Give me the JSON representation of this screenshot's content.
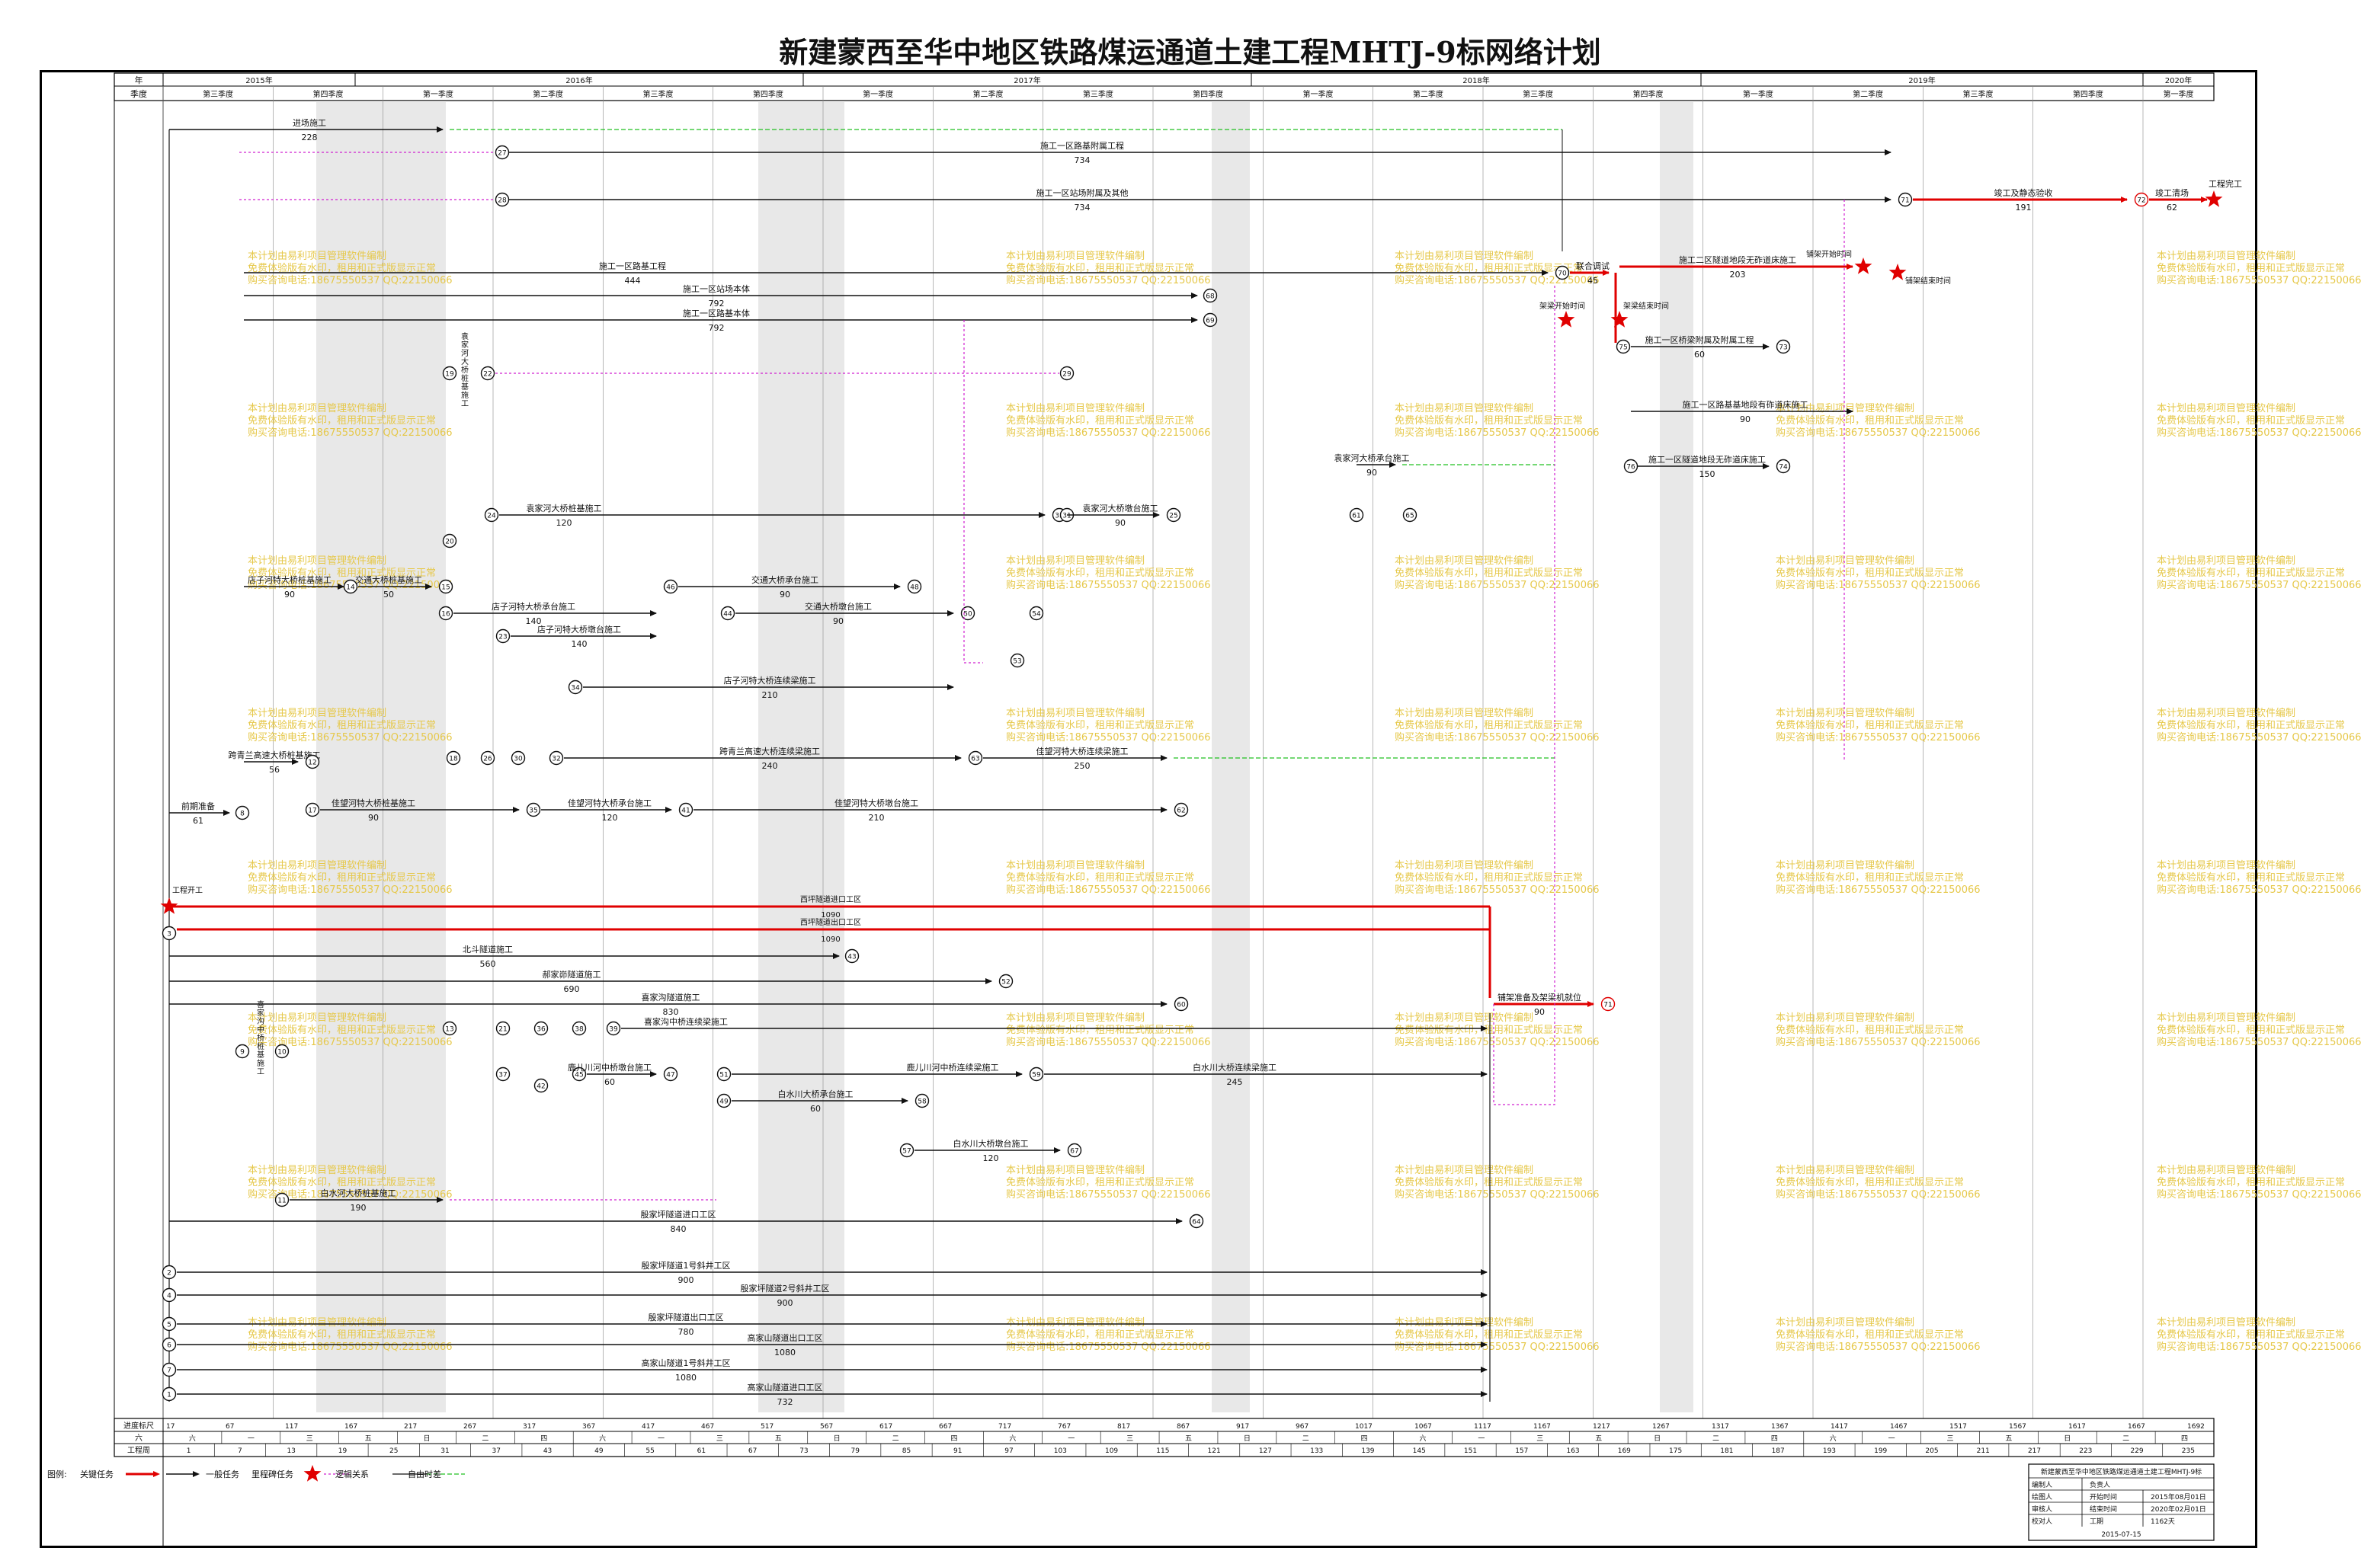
{
  "title": "新建蒙西至华中地区铁路煤运通道土建工程MHTJ-9标网络计划",
  "header": {
    "row1_label": "年",
    "row2_label": "季度",
    "years": [
      "2015年",
      "2016年",
      "2017年",
      "2018年",
      "2019年",
      "2020年"
    ],
    "quarters": [
      "第三季度",
      "第四季度",
      "第一季度",
      "第二季度",
      "第三季度",
      "第四季度",
      "第一季度",
      "第二季度",
      "第三季度",
      "第四季度",
      "第一季度",
      "第二季度",
      "第三季度",
      "第四季度",
      "第一季度",
      "第二季度",
      "第三季度",
      "第四季度",
      "第一季度"
    ]
  },
  "tasks": [
    {
      "name": "进场施工",
      "duration": "228"
    },
    {
      "name": "施工一区路基附属工程",
      "duration": "734"
    },
    {
      "name": "施工一区站场附属及其他",
      "duration": "734"
    },
    {
      "name": "竣工及静态验收",
      "duration": "191"
    },
    {
      "name": "竣工清场",
      "duration": "62"
    },
    {
      "name": "工程完工"
    },
    {
      "name": "施工一区路基工程",
      "duration": "444"
    },
    {
      "name": "施工一区站场本体",
      "duration": "792"
    },
    {
      "name": "施工一区路基本体",
      "duration": "792"
    },
    {
      "name": "联合调试",
      "duration": "45"
    },
    {
      "name": "架梁开始时间"
    },
    {
      "name": "架梁结束时间"
    },
    {
      "name": "施工二区隧道地段无砟道床施工",
      "duration": "203"
    },
    {
      "name": "铺架开始时间"
    },
    {
      "name": "铺架结束时间"
    },
    {
      "name": "施工一区桥梁附属及附属工程",
      "duration": "60"
    },
    {
      "name": "施工一区路基基地段有砟道床施工",
      "duration": "90"
    },
    {
      "name": "施工一区隧道地段无砟道床施工",
      "duration": "150"
    },
    {
      "name": "袁家河大桥桩基施工",
      "duration": "120"
    },
    {
      "name": "袁家河大桥墩台施工",
      "duration": "90"
    },
    {
      "name": "袁家河大桥承台施工",
      "duration": "90"
    },
    {
      "name": "店子河特大桥桩基施工",
      "duration": "90"
    },
    {
      "name": "店子河特大桥承台施工",
      "duration": "140"
    },
    {
      "name": "店子河特大桥墩台施工",
      "duration": "140"
    },
    {
      "name": "交通大桥桩基施工",
      "duration": "50"
    },
    {
      "name": "交通大桥承台施工",
      "duration": "90"
    },
    {
      "name": "交通大桥墩台施工",
      "duration": "90"
    },
    {
      "name": "店子河特大桥连续梁施工",
      "duration": "210"
    },
    {
      "name": "跨青兰高速大桥桩基施工",
      "duration": "56"
    },
    {
      "name": "跨青兰高速大桥连续梁施工",
      "duration": "240"
    },
    {
      "name": "佳望河特大桥连续梁施工",
      "duration": "250"
    },
    {
      "name": "佳望河特大桥桩基施工",
      "duration": "90"
    },
    {
      "name": "佳望河特大桥承台施工",
      "duration": "120"
    },
    {
      "name": "佳望河特大桥墩台施工",
      "duration": "210"
    },
    {
      "name": "前期准备",
      "duration": "61"
    },
    {
      "name": "工程开工"
    },
    {
      "name": "西坪隧道进口工区",
      "duration": "1090"
    },
    {
      "name": "西坪隧道出口工区",
      "duration": "1090"
    },
    {
      "name": "北斗隧道施工",
      "duration": "560"
    },
    {
      "name": "郝家峁隧道施工",
      "duration": "690"
    },
    {
      "name": "喜家沟隧道施工",
      "duration": "830"
    },
    {
      "name": "喜家沟中桥连续梁施工"
    },
    {
      "name": "铺架准备及架梁机就位",
      "duration": "90"
    },
    {
      "name": "鹿儿川河中桥墩台施工",
      "duration": "60"
    },
    {
      "name": "白水川大桥承台施工",
      "duration": "60"
    },
    {
      "name": "白水川大桥墩台施工",
      "duration": "120"
    },
    {
      "name": "鹿儿川河中桥连续梁施工"
    },
    {
      "name": "白水川大桥连续梁施工",
      "duration": "245"
    },
    {
      "name": "白水河大桥桩基施工",
      "duration": "190"
    },
    {
      "name": "殷家坪隧道进口工区",
      "duration": "840"
    },
    {
      "name": "殷家坪隧道1号斜井工区",
      "duration": "900"
    },
    {
      "name": "殷家坪隧道2号斜井工区",
      "duration": "900"
    },
    {
      "name": "殷家坪隧道出口工区",
      "duration": "780"
    },
    {
      "name": "高家山隧道出口工区",
      "duration": "1080"
    },
    {
      "name": "高家山隧道1号斜井工区",
      "duration": "1080"
    },
    {
      "name": "高家山隧道进口工区",
      "duration": "732"
    }
  ],
  "bottom_scale": {
    "row1_label": "进度标尺",
    "row2_label": "六",
    "row3_label": "工程周",
    "day_marks": [
      "17",
      "67",
      "117",
      "167",
      "217",
      "267",
      "317",
      "367",
      "417",
      "467",
      "517",
      "567",
      "617",
      "667",
      "717",
      "767",
      "817",
      "867",
      "917",
      "967",
      "1017",
      "1067",
      "1117",
      "1167",
      "1217",
      "1267",
      "1317",
      "1367",
      "1417",
      "1467",
      "1517",
      "1567",
      "1617",
      "1667",
      "1692"
    ],
    "weekdays": [
      "六",
      "一",
      "三",
      "五",
      "日",
      "二",
      "四",
      "六",
      "一",
      "三",
      "五",
      "日",
      "二",
      "四",
      "六",
      "一",
      "三",
      "五",
      "日",
      "二",
      "四",
      "六",
      "一",
      "三",
      "五",
      "日",
      "二",
      "四",
      "六",
      "一",
      "三",
      "五",
      "日",
      "二",
      "四"
    ],
    "weeks": [
      "1",
      "7",
      "13",
      "19",
      "25",
      "31",
      "37",
      "43",
      "49",
      "55",
      "61",
      "67",
      "73",
      "79",
      "85",
      "91",
      "97",
      "103",
      "109",
      "115",
      "121",
      "127",
      "133",
      "139",
      "145",
      "151",
      "157",
      "163",
      "169",
      "175",
      "181",
      "187",
      "193",
      "199",
      "205",
      "211",
      "217",
      "223",
      "229",
      "235"
    ]
  },
  "legend": {
    "label": "图例:",
    "critical": "关键任务",
    "normal": "一般任务",
    "milestone": "里程碑任务",
    "logic": "逻辑关系",
    "float": "自由时差"
  },
  "info_table": {
    "project": "新建蒙西至华中地区铁路煤运通道土建工程MHTJ-9标",
    "rows": [
      {
        "k": "编制人",
        "v": "负责人"
      },
      {
        "k": "绘图人",
        "v": "开始时间",
        "v2": "2015年08月01日"
      },
      {
        "k": "审核人",
        "v": "结束时间",
        "v2": "2020年02月01日"
      },
      {
        "k": "校对人",
        "v": "工期",
        "v2": "1162天"
      }
    ],
    "date": "2015-07-15"
  },
  "watermark": [
    "本计划由易利项目管理软件编制",
    "免费体验版有水印，租用和正式版显示正常",
    "购买咨询电话:18675550537 QQ:22150066"
  ],
  "colors": {
    "critical": "#e00000",
    "normal": "#111111",
    "logic": "#d020d0",
    "float": "#20c020",
    "shade": "#e8e8e8",
    "watermark": "#e6c84a"
  }
}
